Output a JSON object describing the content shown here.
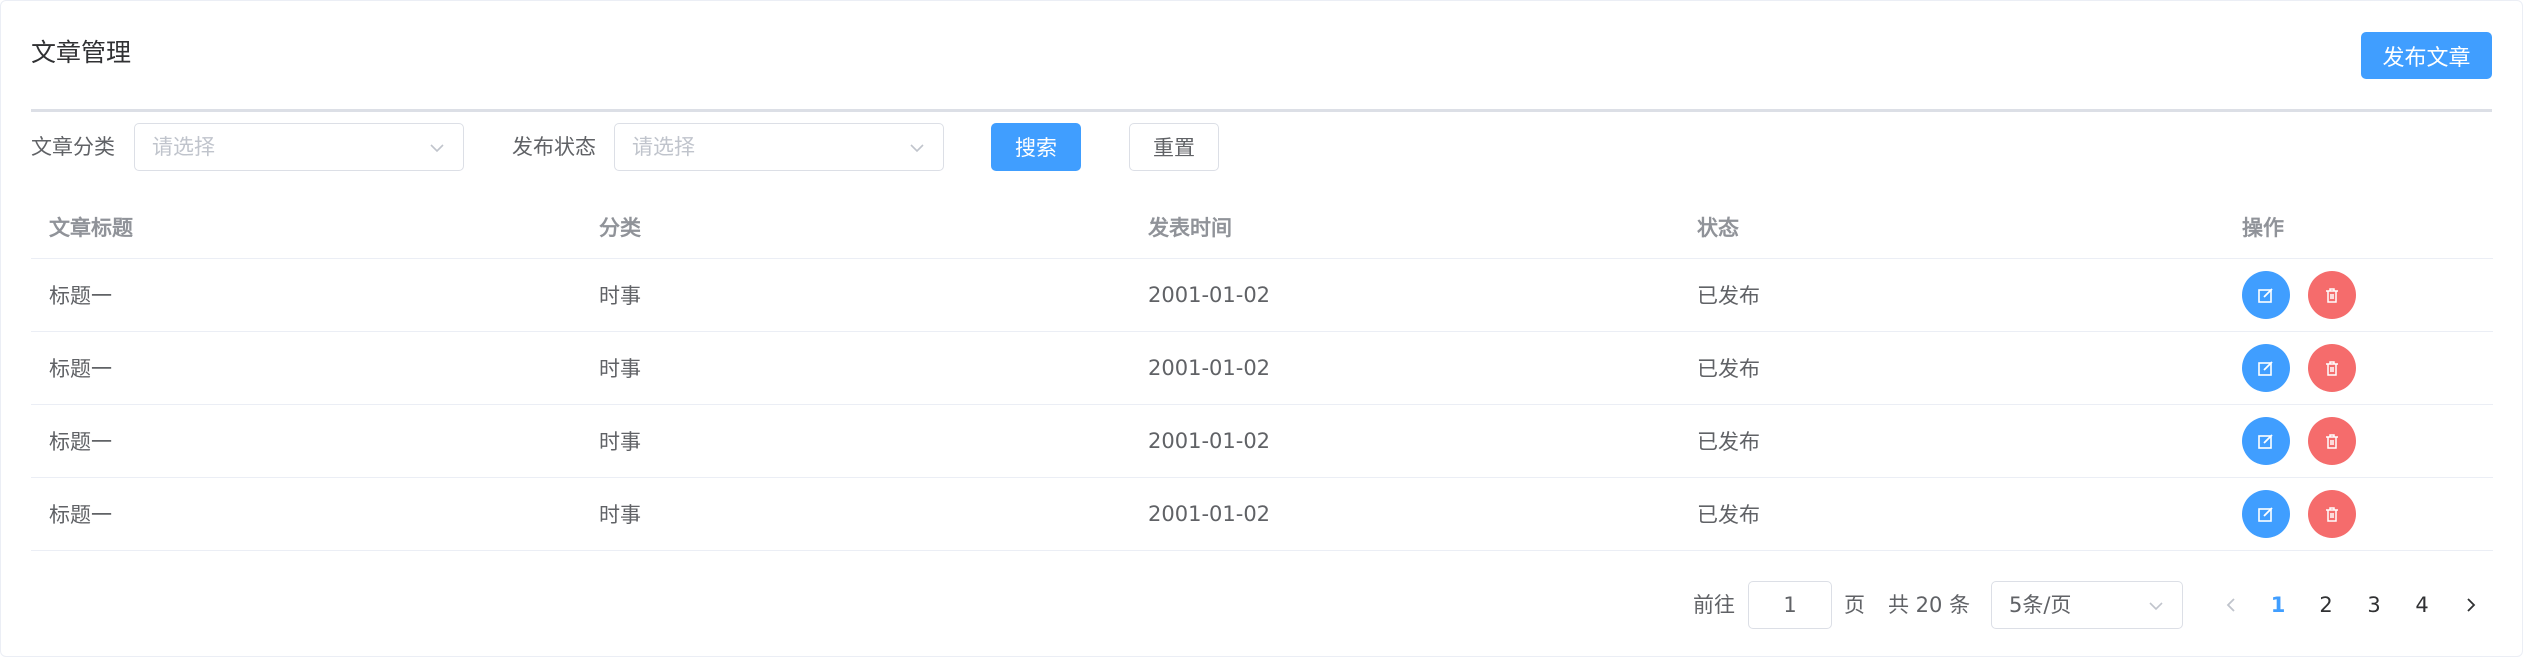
{
  "header": {
    "title": "文章管理",
    "publish_label": "发布文章"
  },
  "filters": {
    "category_label": "文章分类",
    "category_placeholder": "请选择",
    "status_label": "发布状态",
    "status_placeholder": "请选择",
    "search_label": "搜索",
    "reset_label": "重置"
  },
  "table": {
    "columns": [
      "文章标题",
      "分类",
      "发表时间",
      "状态",
      "操作"
    ],
    "rows": [
      {
        "title": "标题一",
        "category": "时事",
        "date": "2001-01-02",
        "status": "已发布"
      },
      {
        "title": "标题一",
        "category": "时事",
        "date": "2001-01-02",
        "status": "已发布"
      },
      {
        "title": "标题一",
        "category": "时事",
        "date": "2001-01-02",
        "status": "已发布"
      },
      {
        "title": "标题一",
        "category": "时事",
        "date": "2001-01-02",
        "status": "已发布"
      }
    ],
    "edit_icon": "edit-icon",
    "delete_icon": "trash-icon"
  },
  "pagination": {
    "goto_prefix": "前往",
    "current_page": "1",
    "goto_suffix": "页",
    "total_text": "共 20 条",
    "page_size": "5条/页",
    "pages": [
      "1",
      "2",
      "3",
      "4"
    ],
    "active_page": "1"
  },
  "colors": {
    "primary": "#409eff",
    "danger": "#f56c6c"
  }
}
